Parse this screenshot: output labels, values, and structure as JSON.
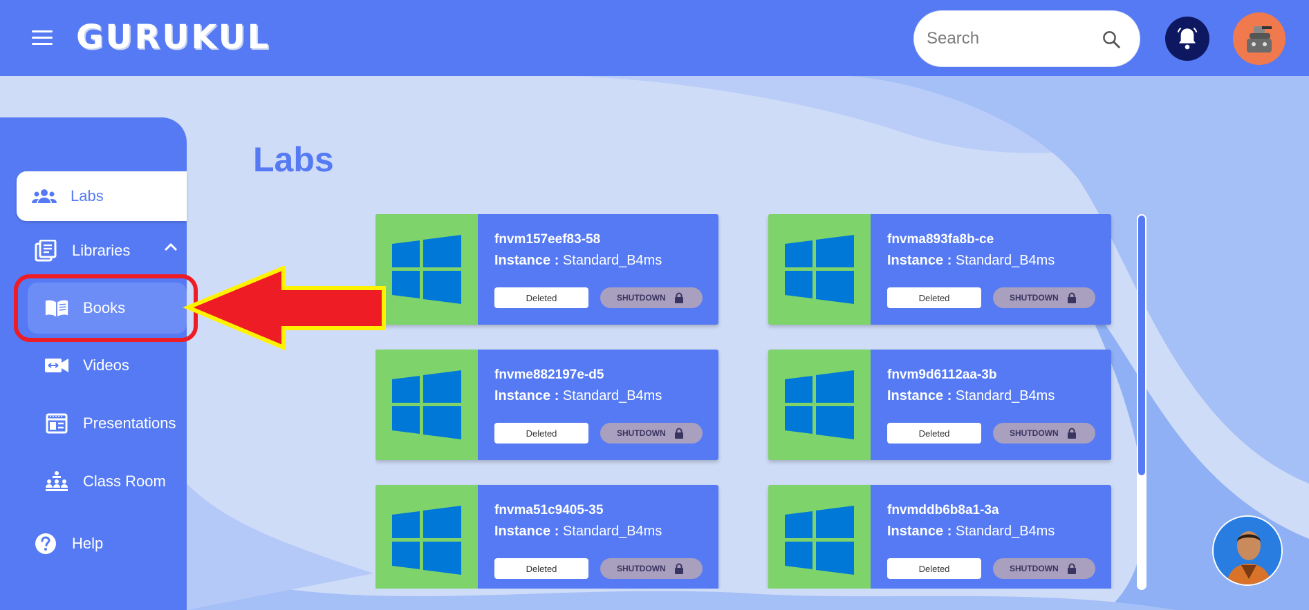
{
  "header": {
    "logo": "GURUKUL",
    "search_placeholder": "Search"
  },
  "sidebar": {
    "items": [
      {
        "label": "Labs",
        "icon": "people-icon"
      },
      {
        "label": "Libraries",
        "icon": "library-icon"
      },
      {
        "label": "Books",
        "icon": "book-icon"
      },
      {
        "label": "Videos",
        "icon": "video-icon"
      },
      {
        "label": "Presentations",
        "icon": "presentation-icon"
      },
      {
        "label": "Class Room",
        "icon": "classroom-icon"
      },
      {
        "label": "Help",
        "icon": "help-icon"
      }
    ]
  },
  "main": {
    "title": "Labs",
    "instance_label": "Instance :",
    "labs": [
      {
        "name": "fnvm157eef83-58",
        "instance": "Standard_B4ms",
        "status": "Deleted",
        "action": "SHUTDOWN"
      },
      {
        "name": "fnvma893fa8b-ce",
        "instance": "Standard_B4ms",
        "status": "Deleted",
        "action": "SHUTDOWN"
      },
      {
        "name": "fnvme882197e-d5",
        "instance": "Standard_B4ms",
        "status": "Deleted",
        "action": "SHUTDOWN"
      },
      {
        "name": "fnvm9d6112aa-3b",
        "instance": "Standard_B4ms",
        "status": "Deleted",
        "action": "SHUTDOWN"
      },
      {
        "name": "fnvma51c9405-35",
        "instance": "Standard_B4ms",
        "status": "Deleted",
        "action": "SHUTDOWN"
      },
      {
        "name": "fnvmddb6b8a1-3a",
        "instance": "Standard_B4ms",
        "status": "Deleted",
        "action": "SHUTDOWN"
      }
    ]
  },
  "colors": {
    "primary": "#557af3",
    "background": "#cfdcf7",
    "thumb_green": "#7ed36a",
    "windows_blue": "#0078d7",
    "annotation_red": "#ee1c25",
    "annotation_yellow": "#fff200"
  }
}
